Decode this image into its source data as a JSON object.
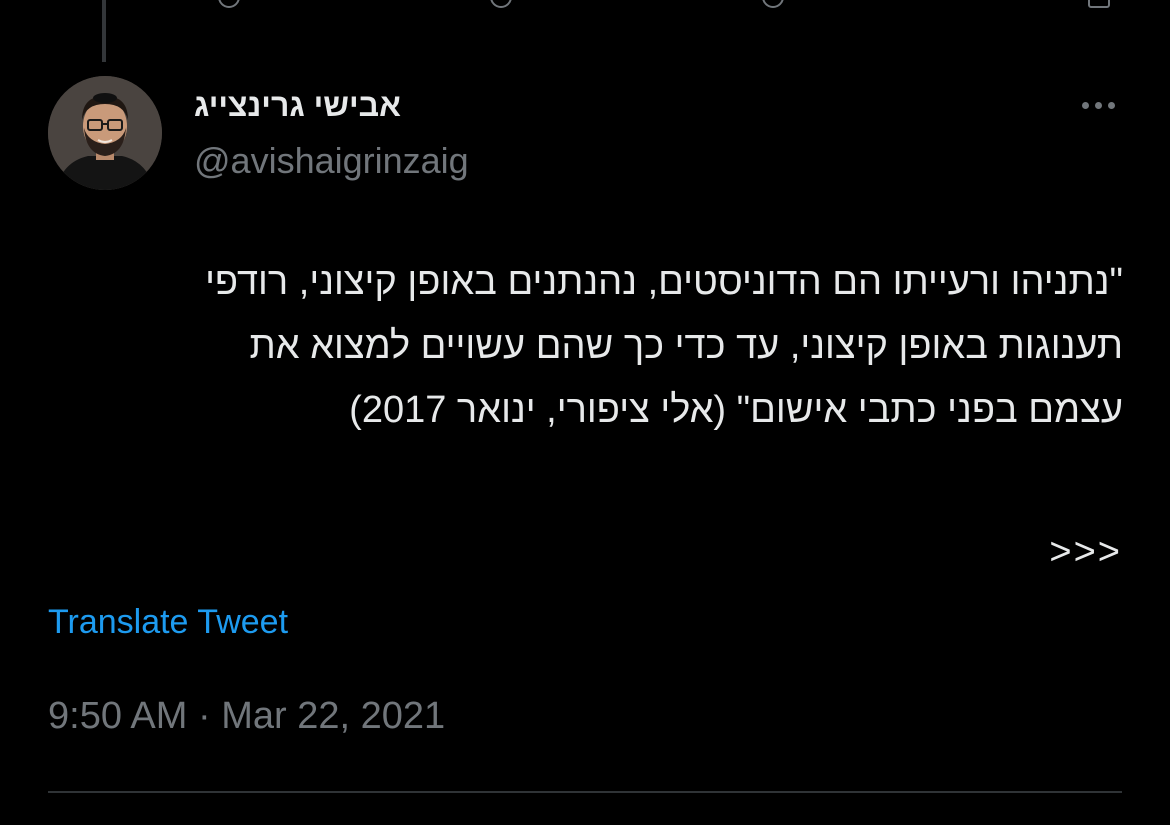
{
  "author": {
    "name": "אבישי גרינצייג",
    "handle": "@avishaigrinzaig"
  },
  "tweet": {
    "text": "\"נתניהו ורעייתו הם הדוניסטים, נהנתנים באופן קיצוני, רודפי\nתענוגות באופן קיצוני, עד כדי כך שהם עשויים למצוא את\nעצמם בפני כתבי אישום\" (אלי ציפורי, ינואר 2017)",
    "continuation": ">>>",
    "translate_label": "Translate Tweet",
    "timestamp": "9:50 AM · Mar 22, 2021"
  },
  "icons": {
    "avatar": "profile-photo",
    "more": "more-horizontal-icon",
    "top_actions": [
      "reply-icon",
      "retweet-icon",
      "like-icon",
      "share-icon"
    ]
  },
  "colors": {
    "background": "#000000",
    "primary_text": "#e7e9ea",
    "secondary_text": "#71767b",
    "link": "#1d9bf0",
    "divider": "#2f3336"
  }
}
